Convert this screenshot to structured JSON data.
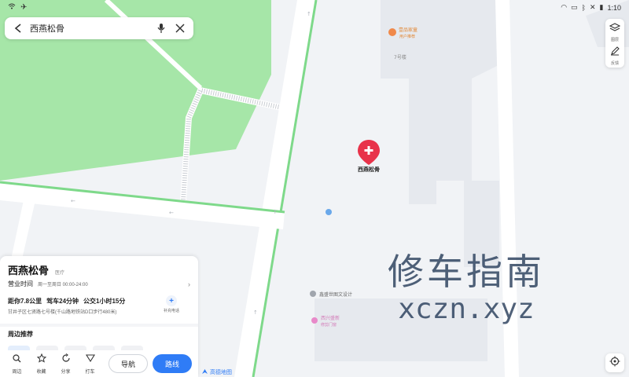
{
  "status_bar": {
    "time": "1:10"
  },
  "search": {
    "query": "西燕松骨"
  },
  "map": {
    "marker_label": "西燕松骨",
    "labels": [
      {
        "text": "壹品家童",
        "kind": "poi-orange"
      },
      {
        "text": "用户推荐",
        "kind": "poi-orange-sub"
      },
      {
        "text": "7号楼",
        "kind": "building"
      },
      {
        "text": "鑫盛世图文设计",
        "kind": "poi-gray"
      },
      {
        "text": "西兴盛新",
        "kind": "poi-pink"
      },
      {
        "text": "修剪门窗",
        "kind": "poi-pink-sub"
      }
    ]
  },
  "right_tools": {
    "layers_label": "图层",
    "feedback_label": "反馈"
  },
  "poi": {
    "name": "西燕松骨",
    "category": "医疗",
    "hours_label": "营业时间",
    "hours_value": "周一至周日 00:00-24:00",
    "distance": "距你7.8公里",
    "drive": "驾车24分钟",
    "transit": "公交1小时15分",
    "address": "甘井子区七贤路七号楼(千山路地铁站D口步行480米)",
    "supplement_label": "补充电话",
    "nearby_title": "周边推荐"
  },
  "actions": {
    "nearby": "周边",
    "favorite": "收藏",
    "share": "分享",
    "taxi": "打车",
    "navigate": "导航",
    "route": "路线"
  },
  "watermark": {
    "cn": "修车指南",
    "en": "xczn.xyz"
  },
  "logo": "高德地图",
  "colors": {
    "accent": "#2f7cf6",
    "marker": "#e8334a",
    "park": "#a6e6a8",
    "road_edge": "#7ed98a"
  }
}
